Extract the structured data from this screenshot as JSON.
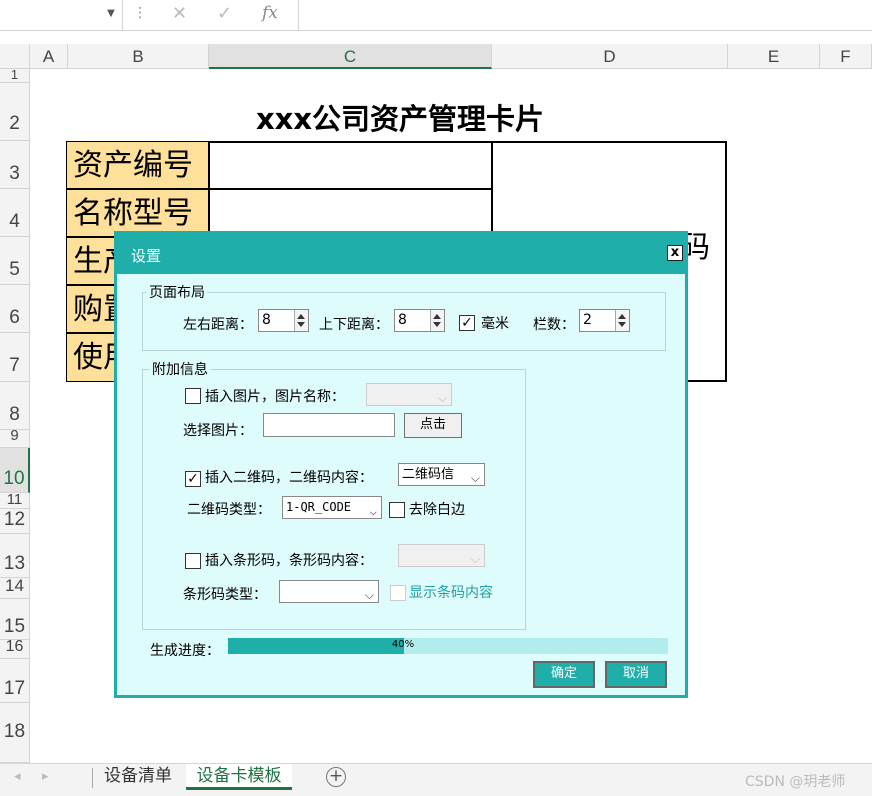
{
  "formula_bar": {
    "cancel_icon": "x-icon",
    "enter_icon": "check-icon",
    "function_label": "fx"
  },
  "columns": [
    "A",
    "B",
    "C",
    "D",
    "E",
    "F"
  ],
  "rows": [
    "1",
    "2",
    "3",
    "4",
    "5",
    "6",
    "7",
    "8",
    "9",
    "10",
    "11",
    "12",
    "13",
    "14",
    "15",
    "16",
    "17",
    "18"
  ],
  "sheet": {
    "title": "xxx公司资产管理卡片",
    "labels": [
      "资产编号",
      "名称型号",
      "生产",
      "购置",
      "使用"
    ],
    "qr_placeholder": "此处放置二维码"
  },
  "dialog": {
    "title": "设置",
    "close_label": "x",
    "page_layout": {
      "group_title": "页面布局",
      "lr_margin_label": "左右距离：",
      "lr_margin_value": "8",
      "tb_margin_label": "上下距离：",
      "tb_margin_value": "8",
      "mm_label": "毫米",
      "mm_checked": true,
      "columns_label": "栏数：",
      "columns_value": "2"
    },
    "extra_info": {
      "group_title": "附加信息",
      "insert_image_label": "插入图片，图片名称：",
      "insert_image_checked": false,
      "choose_image_label": "选择图片：",
      "choose_image_value": "",
      "browse_button": "点击",
      "insert_qr_label": "插入二维码，二维码内容：",
      "insert_qr_checked": true,
      "qr_content_value": "二维码信",
      "qr_type_label": "二维码类型：",
      "qr_type_value": "1-QR_CODE",
      "remove_margin_label": "去除白边",
      "remove_margin_checked": false,
      "insert_barcode_label": "插入条形码，条形码内容：",
      "insert_barcode_checked": false,
      "barcode_type_label": "条形码类型：",
      "show_barcode_text_label": "显示条码内容",
      "show_barcode_text_checked": false
    },
    "progress_label": "生成进度：",
    "progress_value": 0.4,
    "progress_text": "40%",
    "ok_button": "确定",
    "cancel_button": "取消"
  },
  "tabs": [
    "设备清单",
    "设备卡模板"
  ],
  "active_tab": "设备卡模板",
  "add_sheet_label": "+",
  "watermark": "CSDN @玥老师"
}
